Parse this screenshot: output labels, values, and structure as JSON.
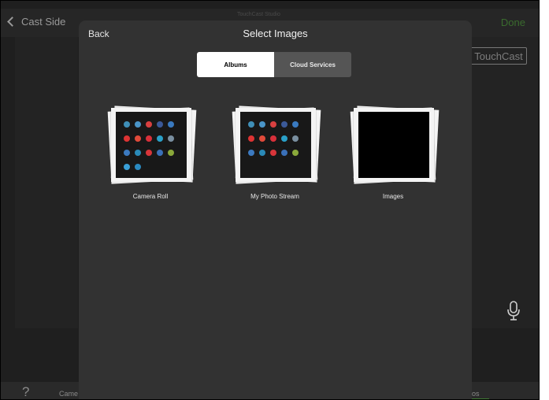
{
  "app": {
    "back_label": "Cast Side",
    "title": "TouchCast Studio",
    "done_label": "Done",
    "logo_text": "TouchCast",
    "help_label": "?",
    "bottom_left_label": "Came",
    "bottom_right_label": "os"
  },
  "modal": {
    "back_label": "Back",
    "title": "Select Images",
    "tabs": [
      {
        "label": "Albums",
        "selected": true
      },
      {
        "label": "Cloud Services",
        "selected": false
      }
    ],
    "albums": [
      {
        "label": "Camera Roll"
      },
      {
        "label": "My Photo Stream"
      },
      {
        "label": "Images"
      }
    ]
  },
  "colors": {
    "background": "#1f1f1f",
    "modal": "#323232",
    "accent_green": "#3e7a33"
  }
}
